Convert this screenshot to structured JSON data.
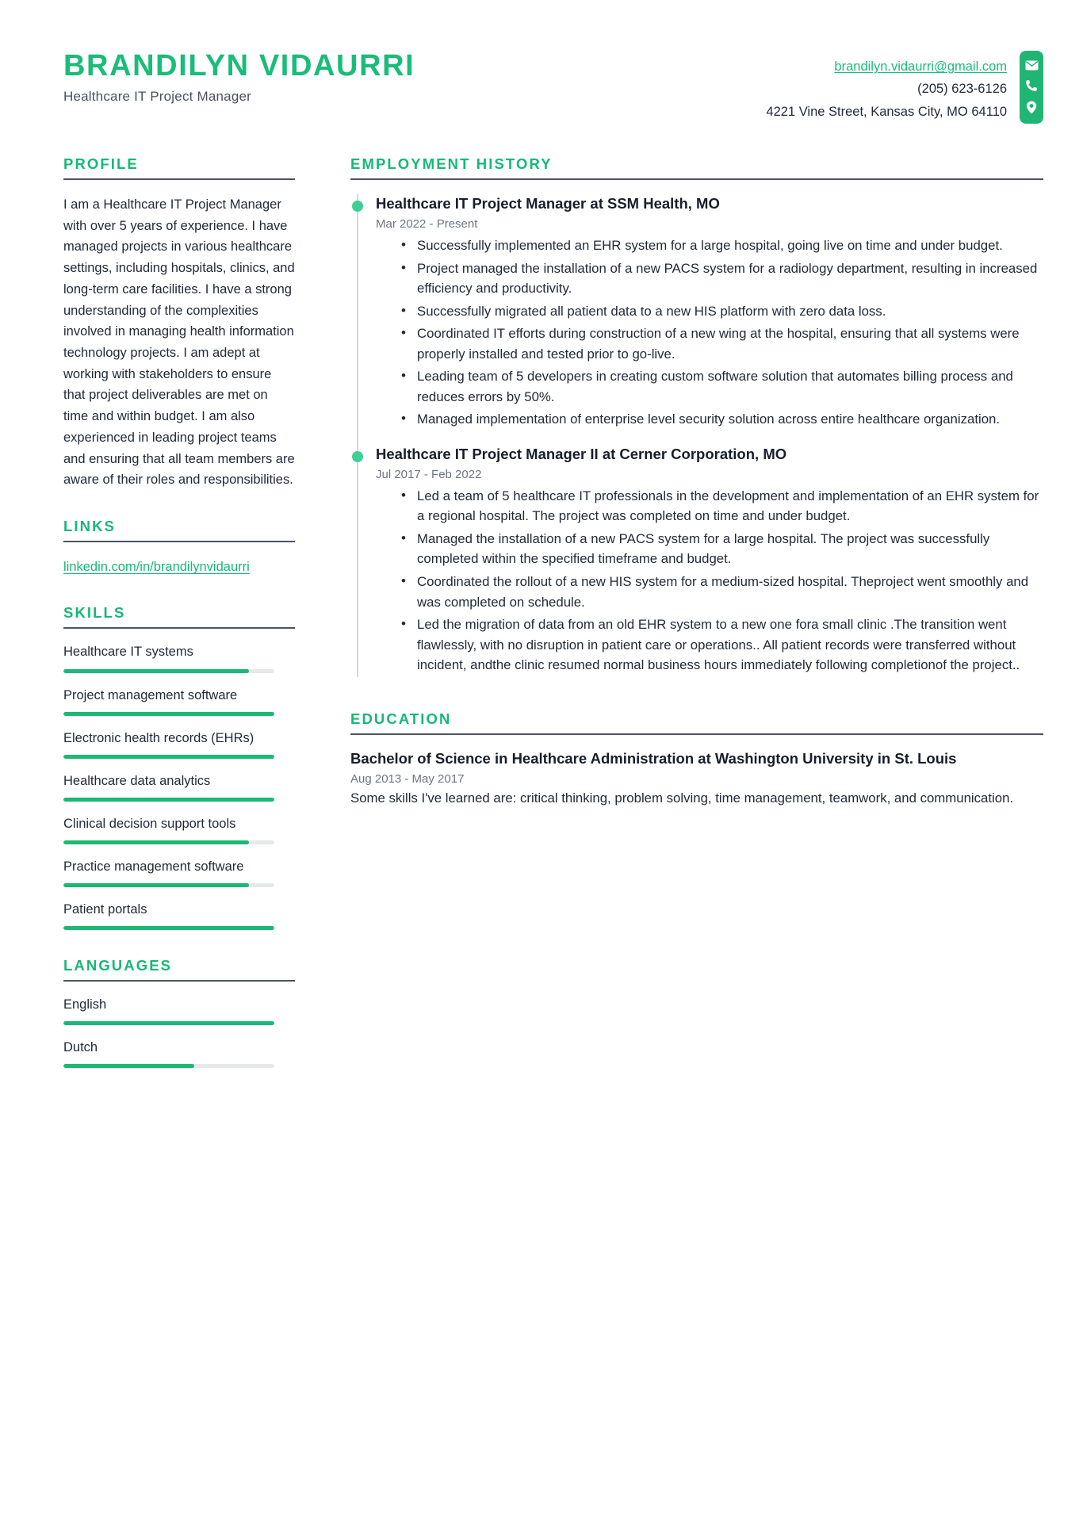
{
  "header": {
    "full_name": "BRANDILYN VIDAURRI",
    "job_title": "Healthcare IT Project Manager",
    "contact": {
      "email": "brandilyn.vidaurri@gmail.com",
      "phone": "(205) 623-6126",
      "address": "4221 Vine Street, Kansas City, MO 64110"
    },
    "icons": [
      "envelope-icon",
      "phone-icon",
      "location-pin-icon"
    ],
    "accent_color": "#1abc79"
  },
  "sidebar": {
    "profile": {
      "title": "PROFILE",
      "text": "I am a Healthcare IT Project Manager with over 5 years of experience. I have managed projects in various healthcare settings, including hospitals, clinics, and long-term care facilities. I have a strong understanding of the complexities involved in managing health information technology projects. I am adept at working with stakeholders to ensure that project deliverables are met on time and within budget. I am also experienced in leading project teams and ensuring that all team members are aware of their roles and responsibilities."
    },
    "links": {
      "title": "LINKS",
      "items": [
        {
          "label": "linkedin.com/in/brandilynvidaurri"
        }
      ]
    },
    "skills": {
      "title": "SKILLS",
      "items": [
        {
          "label": "Healthcare IT systems",
          "level": 88
        },
        {
          "label": "Project management software",
          "level": 100
        },
        {
          "label": "Electronic health records (EHRs)",
          "level": 100
        },
        {
          "label": "Healthcare data analytics",
          "level": 100
        },
        {
          "label": "Clinical decision support tools",
          "level": 88
        },
        {
          "label": "Practice management software",
          "level": 88
        },
        {
          "label": "Patient portals",
          "level": 100
        }
      ]
    },
    "languages": {
      "title": "LANGUAGES",
      "items": [
        {
          "label": "English",
          "level": 100
        },
        {
          "label": "Dutch",
          "level": 62
        }
      ]
    }
  },
  "main": {
    "employment": {
      "title": "EMPLOYMENT HISTORY",
      "jobs": [
        {
          "heading": "Healthcare IT Project Manager at SSM Health, MO",
          "dates": "Mar 2022 - Present",
          "bullets": [
            "Successfully implemented an EHR system for a large hospital, going live on time and under budget.",
            "Project managed the installation of a new PACS system for a radiology department, resulting in increased efficiency and productivity.",
            "Successfully migrated all patient data to a new HIS platform with zero data loss.",
            "Coordinated IT efforts during construction of a new wing at the hospital, ensuring that all systems were properly installed and tested prior to go-live.",
            "Leading team of 5 developers in creating custom software solution that automates billing process and reduces errors by 50%.",
            "Managed implementation of enterprise level security solution across entire healthcare organization."
          ]
        },
        {
          "heading": "Healthcare IT Project Manager II at Cerner Corporation, MO",
          "dates": "Jul 2017 - Feb 2022",
          "bullets": [
            "Led a team of 5 healthcare IT professionals in the development and implementation of an EHR system for a regional hospital. The project was completed on time and under budget.",
            "Managed the installation of a new PACS system for a large hospital. The project was successfully completed within the specified timeframe and budget.",
            "Coordinated the rollout of a new HIS system for a medium-sized hospital. Theproject went smoothly and was completed on schedule.",
            "Led the migration of data from an old EHR system to a new one fora small clinic .The transition went flawlessly, with no disruption in patient care or operations..  All patient records were transferred without incident, andthe clinic resumed normal business hours immediately following completionof the project.."
          ]
        }
      ]
    },
    "education": {
      "title": "EDUCATION",
      "entries": [
        {
          "degree": "Bachelor of Science in Healthcare Administration at Washington University in St. Louis",
          "dates": "Aug 2013 - May 2017",
          "description": "Some skills I've learned are: critical thinking, problem solving, time management, teamwork, and communication."
        }
      ]
    }
  }
}
